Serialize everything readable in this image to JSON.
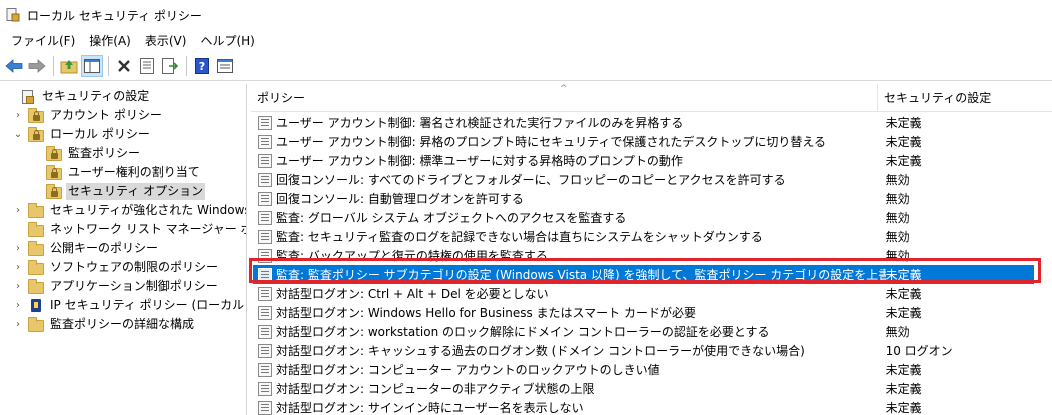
{
  "window": {
    "title": "ローカル セキュリティ ポリシー"
  },
  "menu": {
    "items": [
      "ファイル(F)",
      "操作(A)",
      "表示(V)",
      "ヘルプ(H)"
    ]
  },
  "tree": {
    "items": [
      {
        "label": "セキュリティの設定",
        "expander": "",
        "icon": "security-root-icon"
      },
      {
        "label": "アカウント ポリシー",
        "expander": ">",
        "icon": "folder-icon"
      },
      {
        "label": "ローカル ポリシー",
        "expander": "v",
        "icon": "folder-icon"
      },
      {
        "label": "監査ポリシー",
        "expander": "",
        "icon": "folder-icon"
      },
      {
        "label": "ユーザー権利の割り当て",
        "expander": "",
        "icon": "folder-icon"
      },
      {
        "label": "セキュリティ オプション",
        "expander": "",
        "icon": "folder-icon"
      },
      {
        "label": "セキュリティが強化された Windows Defender",
        "expander": ">",
        "icon": "folder-icon"
      },
      {
        "label": "ネットワーク リスト マネージャー ポリシー",
        "expander": "",
        "icon": "folder-icon"
      },
      {
        "label": "公開キーのポリシー",
        "expander": ">",
        "icon": "folder-icon"
      },
      {
        "label": "ソフトウェアの制限のポリシー",
        "expander": ">",
        "icon": "folder-icon"
      },
      {
        "label": "アプリケーション制御ポリシー",
        "expander": ">",
        "icon": "folder-icon"
      },
      {
        "label": "IP セキュリティ ポリシー (ローカル コンピューター)",
        "expander": ">",
        "icon": "ip-security-icon"
      },
      {
        "label": "監査ポリシーの詳細な構成",
        "expander": ">",
        "icon": "folder-icon"
      }
    ]
  },
  "list": {
    "columns": {
      "policy": "ポリシー",
      "setting": "セキュリティの設定"
    },
    "sort_indicator": "^",
    "rows": [
      {
        "name": "ユーザー アカウント制御: 署名され検証された実行ファイルのみを昇格する",
        "value": "未定義"
      },
      {
        "name": "ユーザー アカウント制御: 昇格のプロンプト時にセキュリティで保護されたデスクトップに切り替える",
        "value": "未定義"
      },
      {
        "name": "ユーザー アカウント制御: 標準ユーザーに対する昇格時のプロンプトの動作",
        "value": "未定義"
      },
      {
        "name": "回復コンソール: すべてのドライブとフォルダーに、フロッピーのコピーとアクセスを許可する",
        "value": "無効"
      },
      {
        "name": "回復コンソール: 自動管理ログオンを許可する",
        "value": "無効"
      },
      {
        "name": "監査: グローバル システム オブジェクトへのアクセスを監査する",
        "value": "無効"
      },
      {
        "name": "監査: セキュリティ監査のログを記録できない場合は直ちにシステムをシャットダウンする",
        "value": "無効"
      },
      {
        "name": "監査: バックアップと復元の特権の使用を監査する",
        "value": "無効"
      },
      {
        "name": "監査: 監査ポリシー サブカテゴリの設定 (Windows Vista 以降) を強制して、監査ポリシー カテゴリの設定を上書きする",
        "value": "未定義"
      },
      {
        "name": "対話型ログオン: Ctrl + Alt + Del を必要としない",
        "value": "未定義"
      },
      {
        "name": "対話型ログオン: Windows Hello for Business またはスマート カードが必要",
        "value": "未定義"
      },
      {
        "name": "対話型ログオン: workstation のロック解除にドメイン コントローラーの認証を必要とする",
        "value": "無効"
      },
      {
        "name": "対話型ログオン: キャッシュする過去のログオン数 (ドメイン コントローラーが使用できない場合)",
        "value": "10 ログオン"
      },
      {
        "name": "対話型ログオン: コンピューター アカウントのロックアウトのしきい値",
        "value": "未定義"
      },
      {
        "name": "対話型ログオン: コンピューターの非アクティブ状態の上限",
        "value": "未定義"
      },
      {
        "name": "対話型ログオン: サインイン時にユーザー名を表示しない",
        "value": "未定義"
      }
    ]
  },
  "colors": {
    "selection": "#0078d7",
    "highlight_box": "#e0242c",
    "tree_selected": "#d9d9d9"
  }
}
